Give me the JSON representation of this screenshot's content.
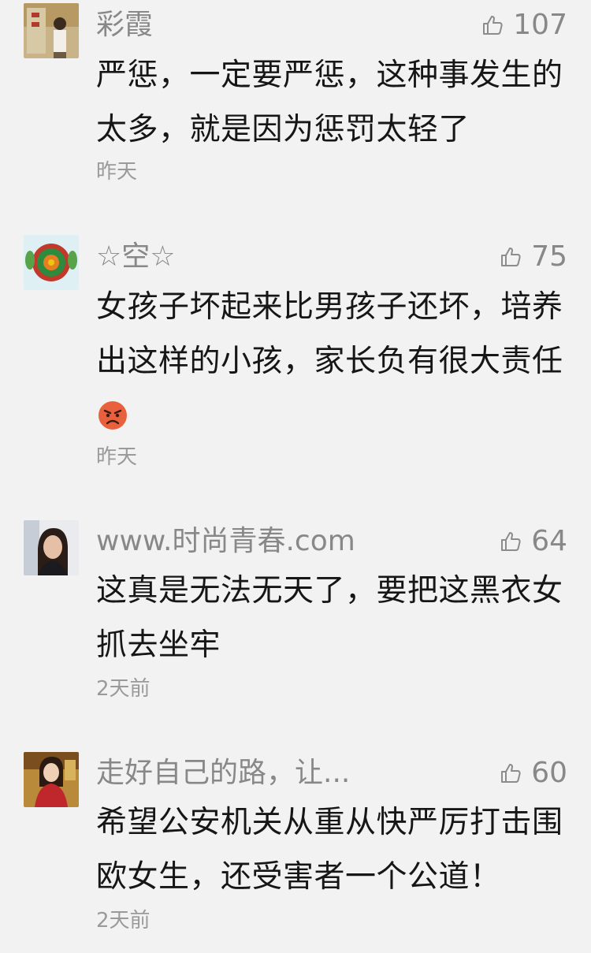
{
  "comments": [
    {
      "name": "彩霞",
      "likes": "107",
      "text_lines": [
        "严惩，一定要严惩，这种事发生的",
        "太多，就是因为惩罚太轻了"
      ],
      "time": "昨天",
      "avatar": "avatar-photo-woman-outdoor"
    },
    {
      "name": "☆空☆",
      "likes": "75",
      "text_lines": [
        "女孩子坏起来比男孩子还坏，培养",
        "出这样的小孩，家长负有很大责任"
      ],
      "emoji": "angry-face-icon",
      "time": "昨天",
      "avatar": "avatar-flower-pattern"
    },
    {
      "name": "www.时尚青春.com",
      "likes": "64",
      "text_lines": [
        "这真是无法无天了，要把这黑衣女",
        "抓去坐牢"
      ],
      "time": "2天前",
      "avatar": "avatar-photo-woman"
    },
    {
      "name": "走好自己的路，让...",
      "likes": "60",
      "text_lines": [
        "希望公安机关从重从快严厉打击围",
        "欧女生，还受害者一个公道！"
      ],
      "time": "2天前",
      "avatar": "avatar-photo-woman-red"
    }
  ],
  "colors": {
    "background": "#f2f2f2",
    "name": "#888888",
    "text": "#161616",
    "time": "#9a9a9a"
  },
  "icons": {
    "like": "thumbs-up-icon"
  }
}
